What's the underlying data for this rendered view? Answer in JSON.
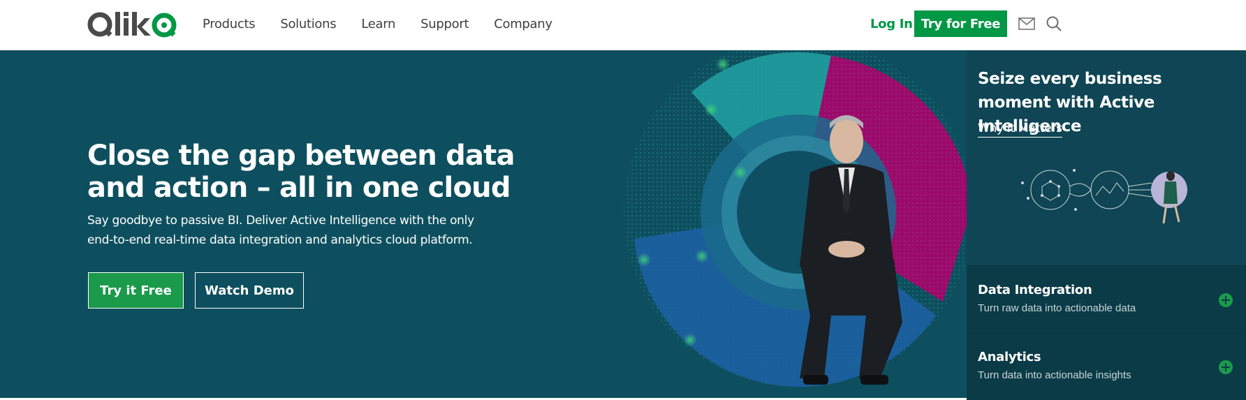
{
  "brand": {
    "name": "Qlik"
  },
  "nav": {
    "items": [
      "Products",
      "Solutions",
      "Learn",
      "Support",
      "Company"
    ],
    "login": "Log In",
    "try_free": "Try for Free",
    "icons": [
      "mail-icon",
      "search-icon"
    ]
  },
  "hero": {
    "title": "Close the gap between data and action – all in one cloud",
    "subtitle": "Say goodbye to passive BI. Deliver Active Intelligence with the only end-to-end real-time data integration and analytics cloud platform.",
    "btn_try": "Try it Free",
    "btn_demo": "Watch Demo"
  },
  "side": {
    "title": "Seize every business moment with Active Intelligence",
    "link": "Why It Matters",
    "accordion": [
      {
        "title": "Data Integration",
        "subtitle": "Turn raw data into actionable data"
      },
      {
        "title": "Analytics",
        "subtitle": "Turn data into actionable insights"
      }
    ]
  },
  "colors": {
    "brand_green": "#009845",
    "hero_bg": "#0d4f5e",
    "side_bg": "#0b3e4a",
    "magenta": "#9c0a6b",
    "teal": "#2aa7a8"
  }
}
